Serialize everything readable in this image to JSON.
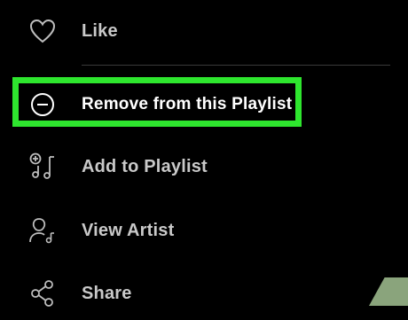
{
  "menu": {
    "items": [
      {
        "label": "Like",
        "icon": "heart-icon"
      },
      {
        "label": "Remove from this Playlist",
        "icon": "minus-circle-icon"
      },
      {
        "label": "Add to Playlist",
        "icon": "add-to-playlist-icon"
      },
      {
        "label": "View Artist",
        "icon": "artist-icon"
      },
      {
        "label": "Share",
        "icon": "share-icon"
      }
    ],
    "highlight_color": "#2ee62e"
  }
}
